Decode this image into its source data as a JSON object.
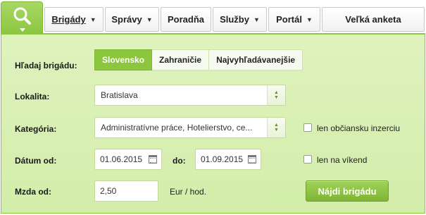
{
  "nav": {
    "tabs": [
      {
        "label": "Brigády",
        "has_arrow": true
      },
      {
        "label": "Správy",
        "has_arrow": true
      },
      {
        "label": "Poradňa",
        "has_arrow": false
      },
      {
        "label": "Služby",
        "has_arrow": true
      },
      {
        "label": "Portál",
        "has_arrow": true
      },
      {
        "label": "Veľká anketa",
        "has_arrow": false
      }
    ],
    "arrow_glyph": "▼"
  },
  "form": {
    "search_label": "Hľadaj brigádu:",
    "subtabs": [
      "Slovensko",
      "Zahraničie",
      "Najvyhľadávanejšie"
    ],
    "location_label": "Lokalita:",
    "location_value": "Bratislava",
    "category_label": "Kategória:",
    "category_value": "Administratívne práce, Hotelierstvo, ce...",
    "civic_only_label": "len občiansku inzerciu",
    "date_from_label": "Dátum od:",
    "date_from_value": "01.06.2015",
    "date_to_label": "do:",
    "date_to_value": "01.09.2015",
    "weekend_only_label": "len na víkend",
    "wage_label": "Mzda od:",
    "wage_value": "2,50",
    "wage_unit": "Eur / hod.",
    "submit_label": "Nájdi brigádu"
  },
  "colors": {
    "accent": "#8cc63f",
    "panel_bg": "#d9efb2"
  }
}
